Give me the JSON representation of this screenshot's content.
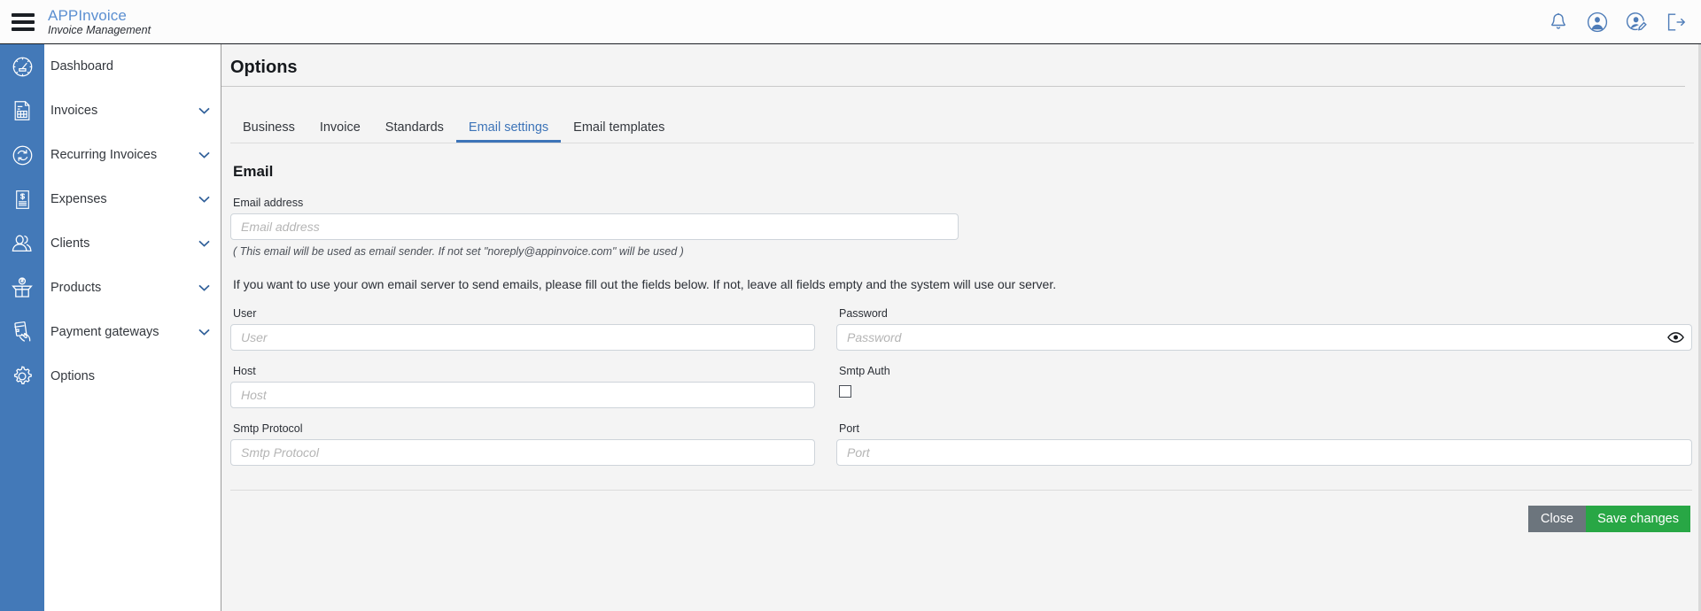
{
  "header": {
    "menu_icon": "hamburger-icon",
    "app_title": "APPInvoice",
    "app_subtitle": "Invoice Management",
    "actions": [
      {
        "name": "notifications-icon",
        "label": "Notifications"
      },
      {
        "name": "user-circle-icon",
        "label": "Account"
      },
      {
        "name": "user-edit-icon",
        "label": "Edit profile"
      },
      {
        "name": "logout-icon",
        "label": "Logout"
      }
    ]
  },
  "sidebar": {
    "rail_color": "#4379b8",
    "items": [
      {
        "label": "Dashboard",
        "icon": "speedometer-icon",
        "has_caret": false
      },
      {
        "label": "Invoices",
        "icon": "invoice-document-icon",
        "has_caret": true
      },
      {
        "label": "Recurring Invoices",
        "icon": "recurring-arrows-icon",
        "has_caret": true
      },
      {
        "label": "Expenses",
        "icon": "expense-receipt-icon",
        "has_caret": true
      },
      {
        "label": "Clients",
        "icon": "users-icon",
        "has_caret": true
      },
      {
        "label": "Products",
        "icon": "product-box-icon",
        "has_caret": true
      },
      {
        "label": "Payment gateways",
        "icon": "credit-card-hand-icon",
        "has_caret": true
      },
      {
        "label": "Options",
        "icon": "gear-icon",
        "has_caret": false
      }
    ]
  },
  "main": {
    "page_title": "Options",
    "tabs": [
      {
        "label": "Business",
        "active": false
      },
      {
        "label": "Invoice",
        "active": false
      },
      {
        "label": "Standards",
        "active": false
      },
      {
        "label": "Email settings",
        "active": true
      },
      {
        "label": "Email templates",
        "active": false
      }
    ],
    "active_tab_color": "#3d74b8",
    "section_title": "Email",
    "email_address": {
      "label": "Email address",
      "value": "",
      "placeholder": "Email address",
      "hint": "( This email will be used as email sender. If not set \"noreply@appinvoice.com\" will be used )"
    },
    "notice": "If you want to use your own email server to send emails, please fill out the fields below. If not, leave all fields empty and the system will use our server.",
    "fields": {
      "user": {
        "label": "User",
        "value": "",
        "placeholder": "User"
      },
      "password": {
        "label": "Password",
        "value": "",
        "placeholder": "Password",
        "reveal_icon": "eye-icon"
      },
      "host": {
        "label": "Host",
        "value": "",
        "placeholder": "Host"
      },
      "smtp_auth": {
        "label": "Smtp Auth",
        "checked": false
      },
      "smtp_protocol": {
        "label": "Smtp Protocol",
        "value": "",
        "placeholder": "Smtp Protocol"
      },
      "port": {
        "label": "Port",
        "value": "",
        "placeholder": "Port"
      }
    },
    "footer": {
      "close_label": "Close",
      "close_color": "#6c757d",
      "save_label": "Save changes",
      "save_color": "#28a745"
    }
  }
}
